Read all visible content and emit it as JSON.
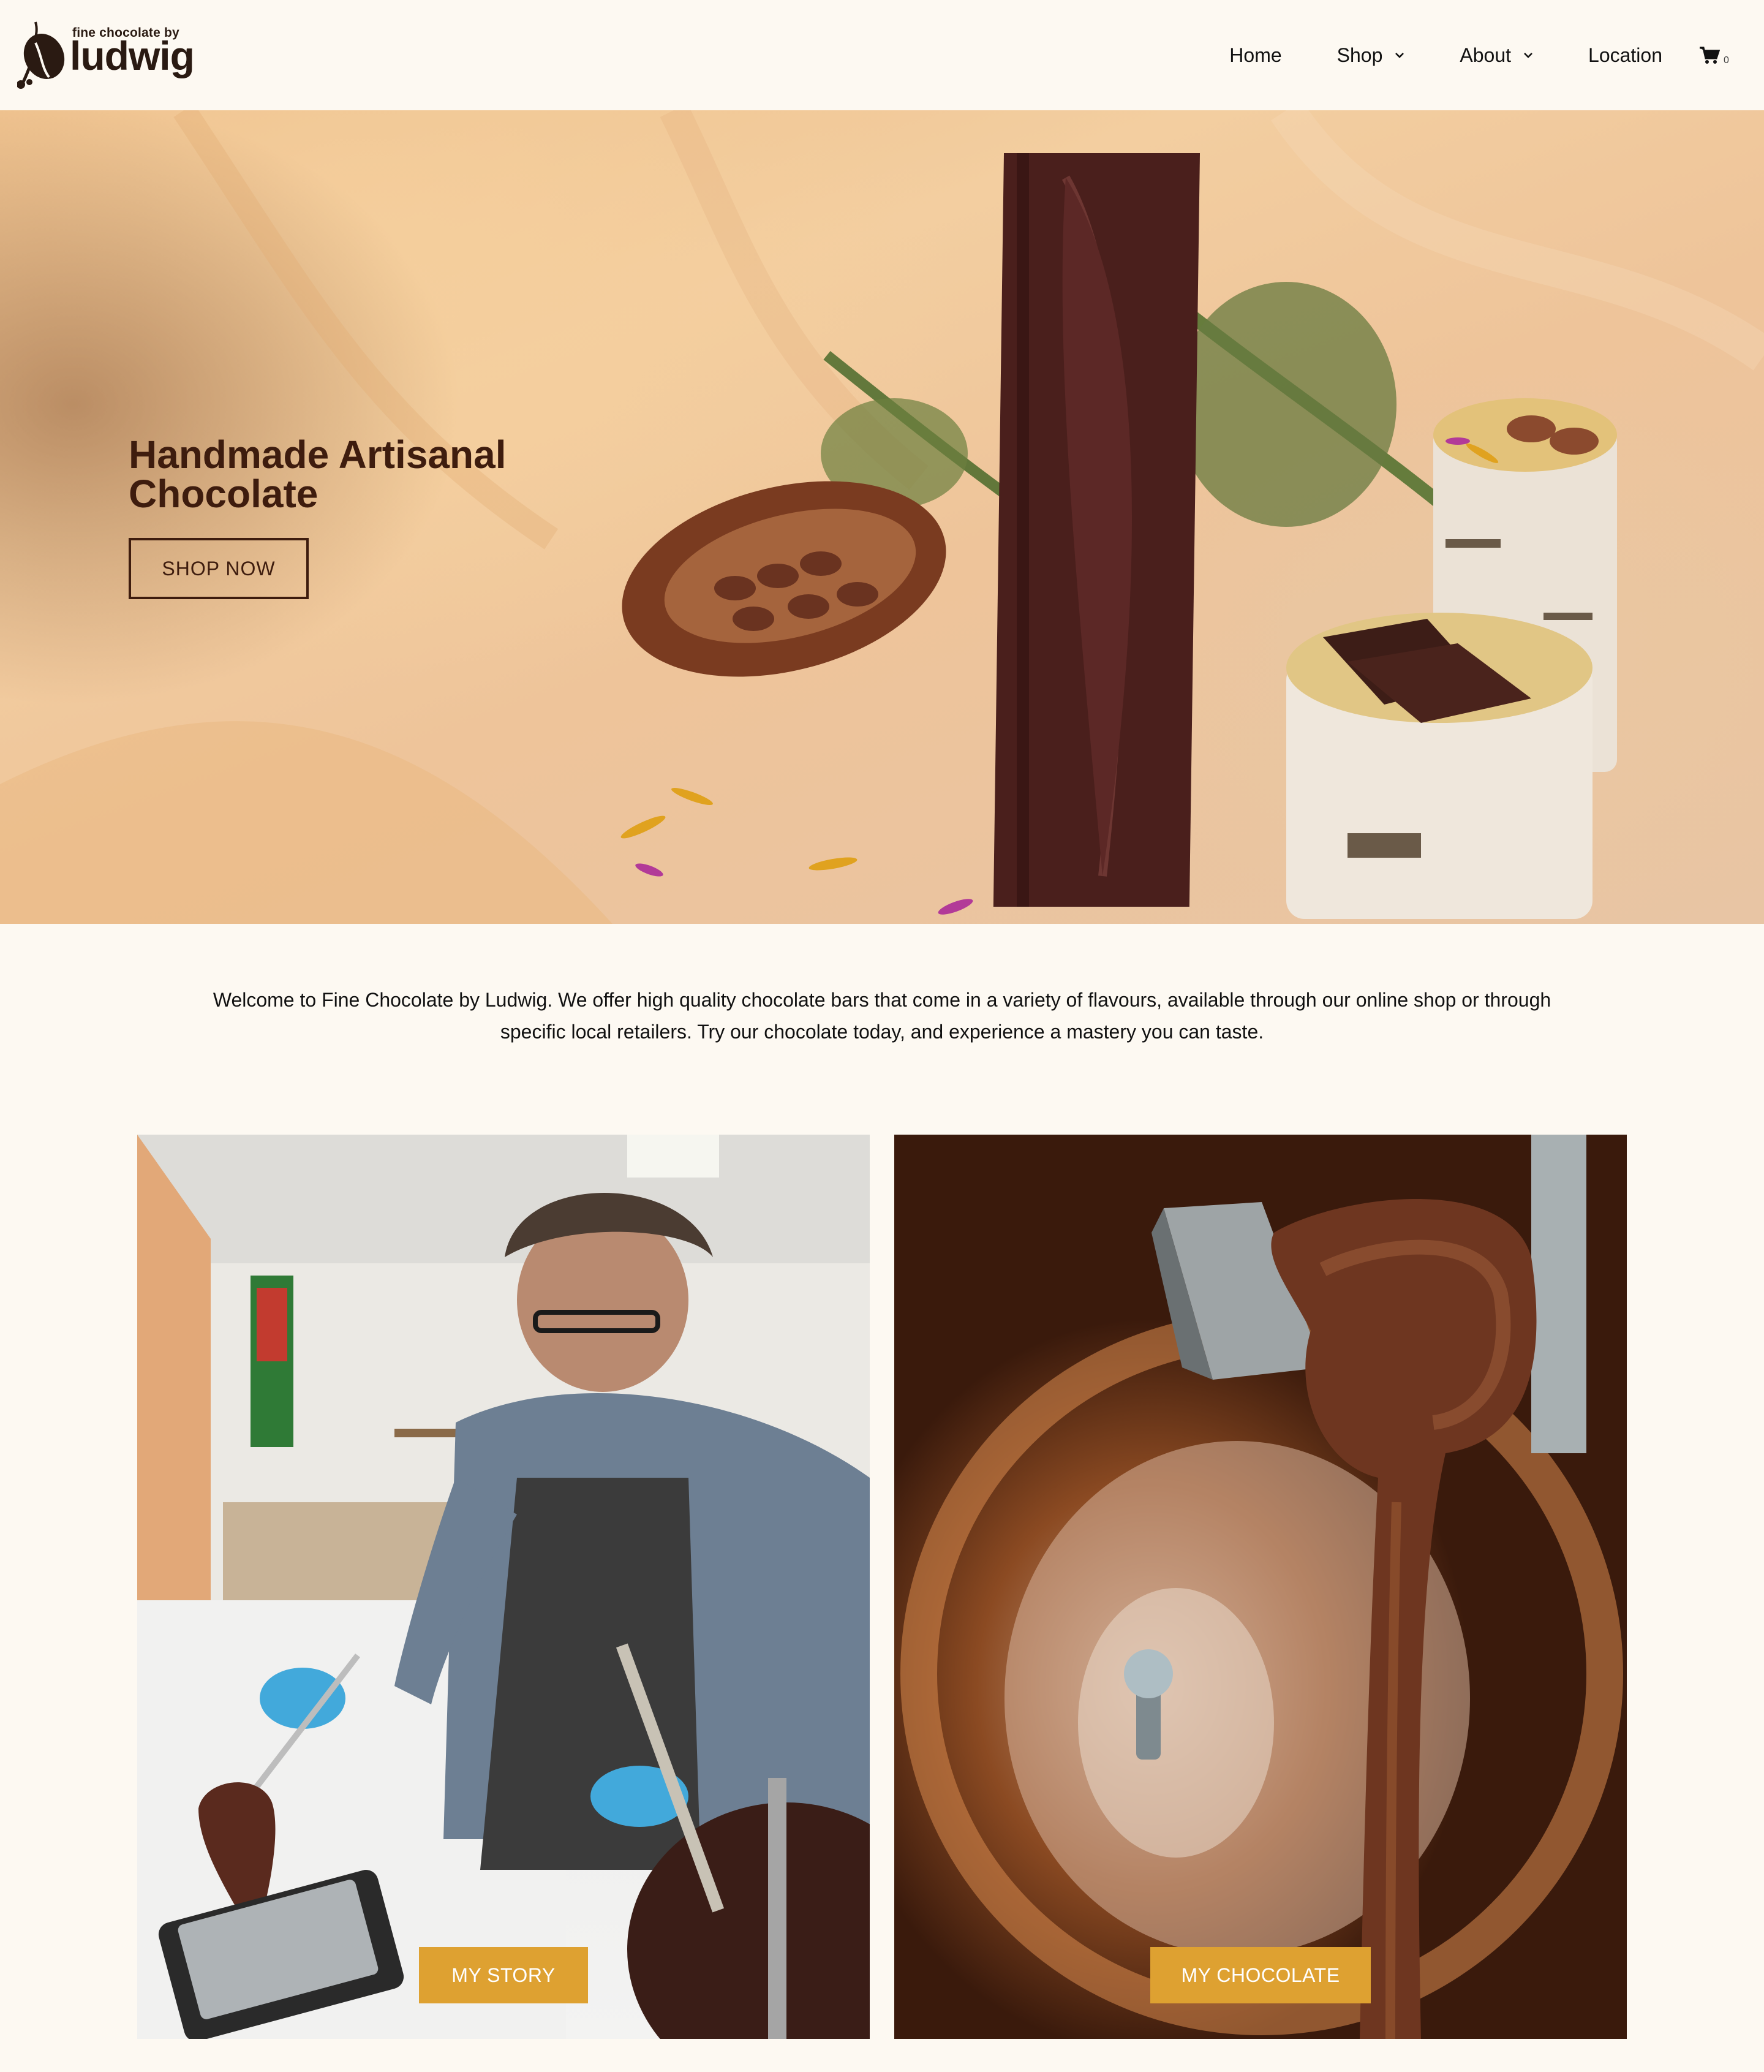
{
  "brand": {
    "tagline": "fine chocolate by",
    "name": "ludwig"
  },
  "nav": {
    "items": [
      {
        "label": "Home",
        "has_dropdown": false
      },
      {
        "label": "Shop",
        "has_dropdown": true
      },
      {
        "label": "About",
        "has_dropdown": true
      },
      {
        "label": "Location",
        "has_dropdown": false
      }
    ],
    "cart_icon": "shopping-cart-icon",
    "cart_count": "0"
  },
  "hero": {
    "title": "Handmade Artisanal Chocolate",
    "button_label": "SHOP NOW"
  },
  "intro": {
    "text": "Welcome to Fine Chocolate by Ludwig. We offer high quality chocolate bars that come in a variety of flavours, available through our online shop or through specific local retailers. Try our chocolate today, and experience a mastery you can taste."
  },
  "cards": [
    {
      "button_label": "MY STORY"
    },
    {
      "button_label": "MY CHOCOLATE"
    }
  ],
  "colors": {
    "background": "#fdf9f2",
    "accent": "#dea131",
    "hero_text": "#3e1c0e"
  }
}
